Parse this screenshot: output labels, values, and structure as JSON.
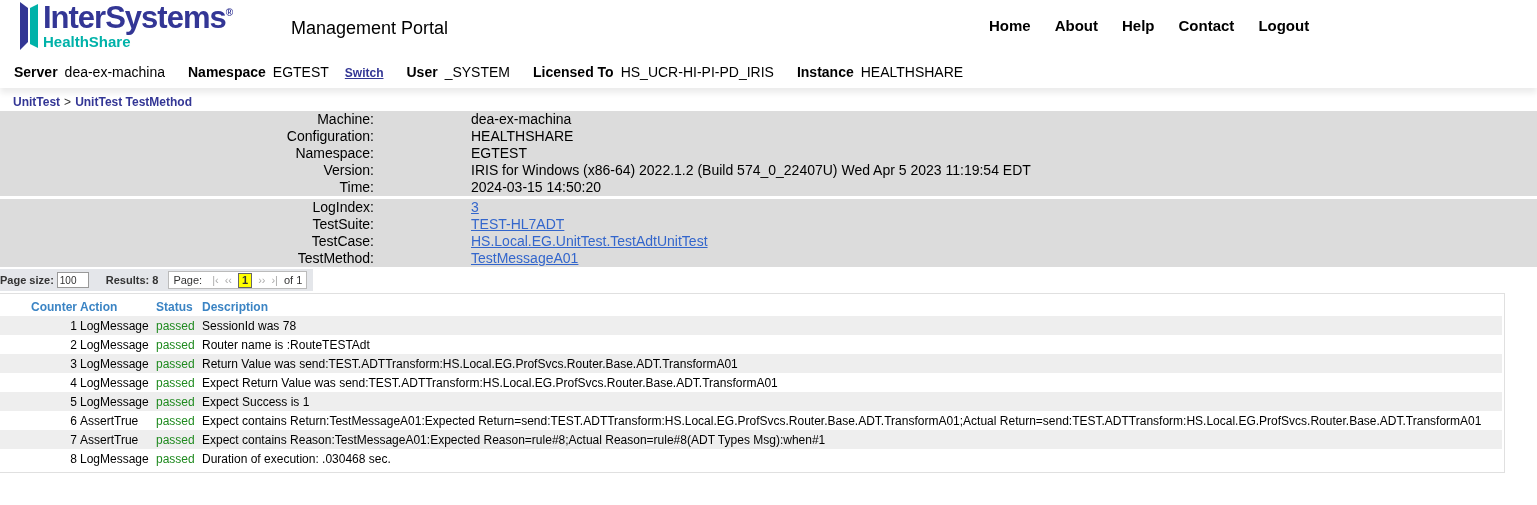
{
  "header": {
    "logo": {
      "brand": "InterSystems",
      "registered": "®",
      "product": "HealthShare"
    },
    "title": "Management Portal",
    "nav": [
      {
        "label": "Home"
      },
      {
        "label": "About"
      },
      {
        "label": "Help"
      },
      {
        "label": "Contact"
      },
      {
        "label": "Logout"
      }
    ]
  },
  "info_bar": [
    {
      "label": "Server",
      "value": "dea-ex-machina"
    },
    {
      "label": "Namespace",
      "value": "EGTEST",
      "link": "Switch"
    },
    {
      "label": "User",
      "value": "_SYSTEM"
    },
    {
      "label": "Licensed To",
      "value": "HS_UCR-HI-PI-PD_IRIS"
    },
    {
      "label": "Instance",
      "value": "HEALTHSHARE"
    }
  ],
  "breadcrumb": {
    "items": [
      {
        "label": "UnitTest"
      },
      {
        "label": "UnitTest TestMethod"
      }
    ],
    "separator": ">"
  },
  "panels": [
    {
      "fields": [
        {
          "label": "Machine:",
          "value": "dea-ex-machina",
          "kind": "text"
        },
        {
          "label": "Configuration:",
          "value": "HEALTHSHARE",
          "kind": "text"
        },
        {
          "label": "Namespace:",
          "value": "EGTEST",
          "kind": "text"
        },
        {
          "label": "Version:",
          "value": "IRIS for Windows (x86-64) 2022.1.2 (Build 574_0_22407U) Wed Apr 5 2023 11:19:54 EDT",
          "kind": "text"
        },
        {
          "label": "Time:",
          "value": "2024-03-15 14:50:20",
          "kind": "text"
        }
      ]
    },
    {
      "fields": [
        {
          "label": "LogIndex:",
          "value": "3",
          "kind": "link"
        },
        {
          "label": "TestSuite:",
          "value": "TEST-HL7ADT",
          "kind": "link"
        },
        {
          "label": "TestCase:",
          "value": "HS.Local.EG.UnitTest.TestAdtUnitTest",
          "kind": "link"
        },
        {
          "label": "TestMethod:",
          "value": "TestMessageA01",
          "kind": "link"
        }
      ]
    }
  ],
  "pager": {
    "page_size_label": "Page size:",
    "page_size": "100",
    "results": "Results: 8",
    "page_label": "Page:",
    "first": "|‹",
    "previous": "‹‹",
    "pages": [
      {
        "label": "1",
        "selected": true
      }
    ],
    "next": "››",
    "last": "›|",
    "of": "of 1"
  },
  "table": {
    "columns": [
      "Counter",
      "Action",
      "Status",
      "Description"
    ],
    "rows": [
      {
        "counter": "1",
        "action": "LogMessage",
        "status": "passed",
        "description": "SessionId was 78"
      },
      {
        "counter": "2",
        "action": "LogMessage",
        "status": "passed",
        "description": "Router name is :RouteTESTAdt"
      },
      {
        "counter": "3",
        "action": "LogMessage",
        "status": "passed",
        "description": "Return Value was send:TEST.ADTTransform:HS.Local.EG.ProfSvcs.Router.Base.ADT.TransformA01"
      },
      {
        "counter": "4",
        "action": "LogMessage",
        "status": "passed",
        "description": "Expect Return Value was send:TEST.ADTTransform:HS.Local.EG.ProfSvcs.Router.Base.ADT.TransformA01"
      },
      {
        "counter": "5",
        "action": "LogMessage",
        "status": "passed",
        "description": "Expect Success is 1"
      },
      {
        "counter": "6",
        "action": "AssertTrue",
        "status": "passed",
        "description": "Expect contains Return:TestMessageA01:Expected Return=send:TEST.ADTTransform:HS.Local.EG.ProfSvcs.Router.Base.ADT.TransformA01;Actual Return=send:TEST.ADTTransform:HS.Local.EG.ProfSvcs.Router.Base.ADT.TransformA01"
      },
      {
        "counter": "7",
        "action": "AssertTrue",
        "status": "passed",
        "description": "Expect contains Reason:TestMessageA01:Expected Reason=rule#8;Actual Reason=rule#8(ADT Types Msg):when#1"
      },
      {
        "counter": "8",
        "action": "LogMessage",
        "status": "passed",
        "description": "Duration of execution: .030468 sec."
      }
    ]
  }
}
